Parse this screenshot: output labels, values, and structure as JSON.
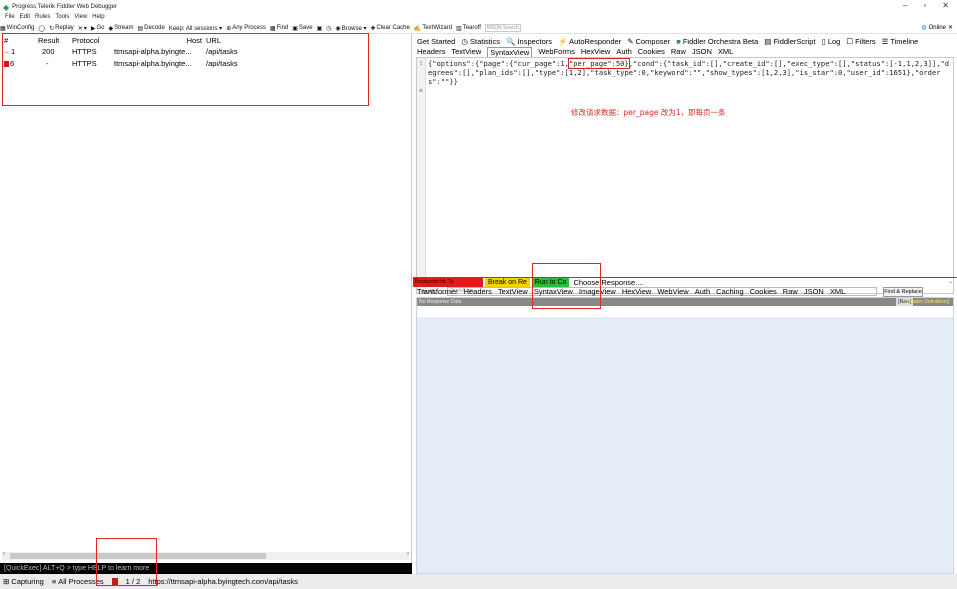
{
  "window": {
    "title": "Progress Telerik Fiddler Web Debugger",
    "minimize": "–",
    "maximize": "▫",
    "close": "✕"
  },
  "menu": [
    "File",
    "Edit",
    "Rules",
    "Tools",
    "View",
    "Help"
  ],
  "toolbar": {
    "items": [
      {
        "icon": "winconfig-icon",
        "glyph": "▦",
        "label": "WinConfig"
      },
      {
        "icon": "comment-icon",
        "glyph": "◯",
        "label": ""
      },
      {
        "icon": "replay-icon",
        "glyph": "↻",
        "label": "Replay"
      },
      {
        "icon": "remove-icon",
        "glyph": "✕",
        "label": "▾"
      },
      {
        "icon": "go-icon",
        "glyph": "▶",
        "label": "Go"
      },
      {
        "icon": "stream-icon",
        "glyph": "◆",
        "label": "Stream"
      },
      {
        "icon": "decode-icon",
        "glyph": "▤",
        "label": "Decode"
      },
      {
        "icon": "keep-icon",
        "glyph": "",
        "label": "Keep: All sessions ▾"
      },
      {
        "icon": "process-icon",
        "glyph": "⊕",
        "label": "Any Process"
      },
      {
        "icon": "find-icon",
        "glyph": "▦",
        "label": "Find"
      },
      {
        "icon": "save-icon",
        "glyph": "▣",
        "label": "Save"
      },
      {
        "icon": "camera-icon",
        "glyph": "▣",
        "label": ""
      },
      {
        "icon": "timer-icon",
        "glyph": "◷",
        "label": ""
      },
      {
        "icon": "browse-icon",
        "glyph": "◉",
        "label": "Browse ▾"
      },
      {
        "icon": "clear-cache-icon",
        "glyph": "✚",
        "label": "Clear Cache"
      },
      {
        "icon": "textwizard-icon",
        "glyph": "✍",
        "label": "TextWizard"
      },
      {
        "icon": "tearoff-icon",
        "glyph": "▥",
        "label": "Tearoff"
      }
    ],
    "search_placeholder": "MSDN Search...",
    "online_label": "Online",
    "online_close": "✕"
  },
  "sessions": {
    "columns": {
      "num": "#",
      "result": "Result",
      "protocol": "Protocol",
      "host": "Host",
      "url": "URL"
    },
    "rows": [
      {
        "num": "1",
        "icon": "arrow-icon",
        "result": "200",
        "protocol": "HTTPS",
        "host": "ttmsapi-alpha.byingte...",
        "url": "/api/tasks"
      },
      {
        "num": "6",
        "icon": "breakpoint-icon",
        "result": "-",
        "protocol": "HTTPS",
        "host": "ttmsapi-alpha.byingte...",
        "url": "/api/tasks"
      }
    ]
  },
  "quickexec": "[QuickExec] ALT+Q > type HELP to learn more",
  "status": {
    "capturing": "Capturing",
    "processes": "All Processes",
    "count": "1 / 2",
    "url": "https://ttmsapi-alpha.byingtech.com/api/tasks"
  },
  "inspector": {
    "tabs_row1": [
      "Get Started",
      "Statistics",
      "Inspectors",
      "AutoResponder",
      "Composer",
      "Fiddler Orchestra Beta",
      "FiddlerScript",
      "Log",
      "Filters",
      "Timeline"
    ],
    "tabs_row2": [
      "Headers",
      "TextView",
      "SyntaxView",
      "WebForms",
      "HexView",
      "Auth",
      "Cookies",
      "Raw",
      "JSON",
      "XML"
    ],
    "active_row2": "SyntaxView",
    "request_before": "{\"options\":{\"page\":{\"cur_page\":1,",
    "request_highlight": "\"per_page\":50}",
    "request_after": ",\"cond\":{\"task_id\":[],\"create_id\":[],\"exec_type\":[],\"status\":[-1,1,2,3]],\"degrees\":[],\"plan_ids\":[],\"type\":[1,2],\"task_type\":0,\"keyword\":\"\",\"show_types\":[1,2,3],\"is_star\":0,\"user_id\":1651},\"orders\":\"\"}}",
    "gutter": "1\n\n\n⊕",
    "annotation": "修改请求数据：per_page 改为1，即每页一条",
    "find_label": "ln:45",
    "find_placeholder": "QuickFind...",
    "find_button": "Find & Replace"
  },
  "breakpoint": {
    "label": "Breakpoint hit. Ta",
    "break_on_response": "Break on Re",
    "run_to_completion": "Run to Co",
    "choose_response": "Choose Response....",
    "dropdown": "⌄"
  },
  "response": {
    "tabs": [
      "Transformer",
      "Headers",
      "TextView",
      "SyntaxView",
      "ImageView",
      "HexView",
      "WebView",
      "Auth",
      "Caching",
      "Cookies",
      "Raw",
      "JSON",
      "XML"
    ],
    "header_text": "No Response Data",
    "raw_btn": "[Raw]",
    "defs_btn": "[Header Definitions]"
  },
  "colors": {
    "accent_red": "#e02a20",
    "break_yellow": "#f4d300",
    "run_green": "#2dbd3a",
    "response_bg": "#e4edf8"
  }
}
